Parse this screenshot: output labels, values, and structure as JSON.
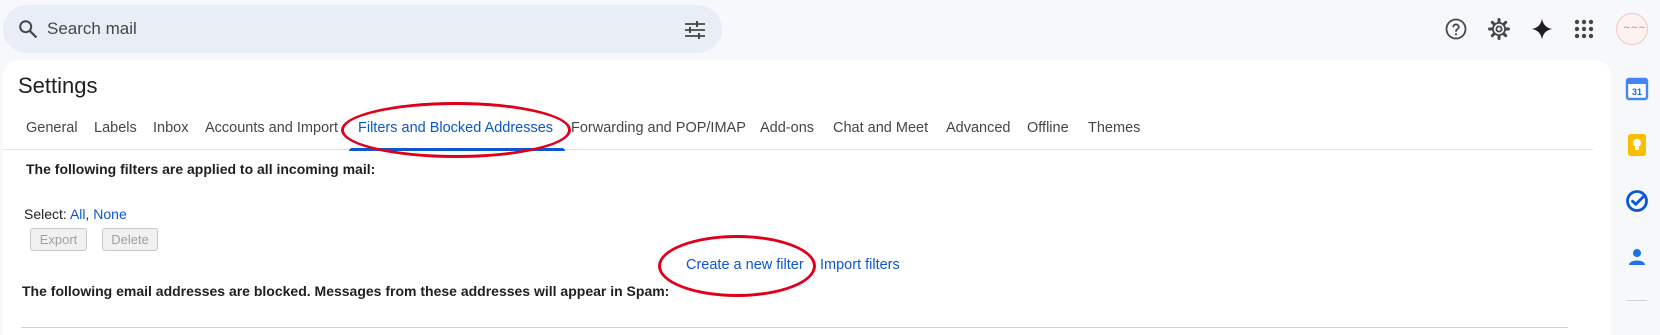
{
  "search": {
    "placeholder": "Search mail"
  },
  "page": {
    "title": "Settings"
  },
  "tabs": [
    {
      "label": "General"
    },
    {
      "label": "Labels"
    },
    {
      "label": "Inbox"
    },
    {
      "label": "Accounts and Import"
    },
    {
      "label": "Filters and Blocked Addresses",
      "active": true
    },
    {
      "label": "Forwarding and POP/IMAP"
    },
    {
      "label": "Add-ons"
    },
    {
      "label": "Chat and Meet"
    },
    {
      "label": "Advanced"
    },
    {
      "label": "Offline"
    },
    {
      "label": "Themes"
    }
  ],
  "filters": {
    "heading": "The following filters are applied to all incoming mail:",
    "select_label": "Select:",
    "select_all": "All",
    "select_separator": ",",
    "select_none": "None",
    "export_label": "Export",
    "delete_label": "Delete",
    "create_link": "Create a new filter",
    "import_link": "Import filters"
  },
  "blocked": {
    "heading": "The following email addresses are blocked. Messages from these addresses will appear in Spam:"
  },
  "colors": {
    "accent": "#0b57d0",
    "annotation": "#e0001b",
    "search_bg": "#e9eef6",
    "page_bg": "#f6f8fc"
  },
  "icons": {
    "topbar": [
      "help-icon",
      "settings-gear-icon",
      "gemini-sparkle-icon",
      "apps-grid-icon",
      "account-avatar"
    ],
    "sidepanel": [
      "calendar-icon",
      "keep-icon",
      "tasks-icon",
      "contacts-icon"
    ]
  }
}
